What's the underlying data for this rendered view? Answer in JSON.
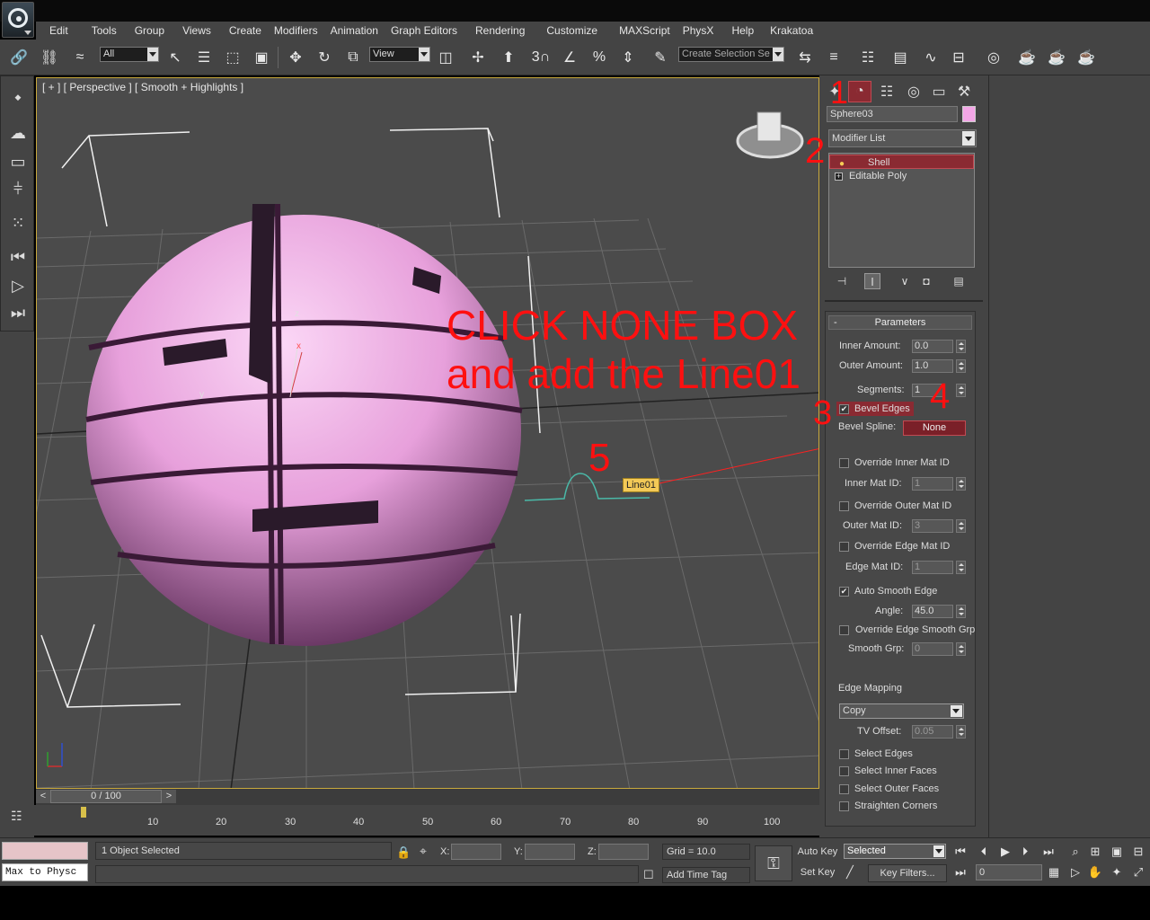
{
  "app": {
    "logo_icon": "max-logo-icon"
  },
  "menubar": {
    "items": [
      "Edit",
      "Tools",
      "Group",
      "Views",
      "Create",
      "Modifiers",
      "Animation",
      "Graph Editors",
      "Rendering",
      "Customize",
      "MAXScript",
      "PhysX",
      "Help",
      "Krakatoa"
    ]
  },
  "toolbar": {
    "selection_filter": "All",
    "ref_coord": "View",
    "named_selection_placeholder": "Create Selection Se"
  },
  "viewport": {
    "label": "[ + ] [ Perspective ] [ Smooth + Highlights ]",
    "annotation_main_line1": "CLICK NONE BOX",
    "annotation_main_line2": "and add the Line01",
    "step_numbers": [
      "1",
      "2",
      "3",
      "4",
      "5"
    ],
    "line_tag": "Line01",
    "axis_x": "x",
    "axis_y": "y",
    "axis_z": "z",
    "sphere_color": "#f3a6e6",
    "annotation_color": "#ff1010"
  },
  "timeslider": {
    "position_text": "0 / 100",
    "prev": "<",
    "next": ">",
    "ticks": [
      "10",
      "20",
      "30",
      "40",
      "50",
      "60",
      "70",
      "80",
      "90",
      "100"
    ]
  },
  "command_panel": {
    "object_name": "Sphere03",
    "object_color": "#f3a6e6",
    "modifier_list": "Modifier List",
    "stack": [
      "Shell",
      "Editable Poly"
    ],
    "rollout_title": "Parameters",
    "rollout_toggle": "-",
    "params": {
      "inner_amount_label": "Inner Amount:",
      "inner_amount": "0.0",
      "outer_amount_label": "Outer Amount:",
      "outer_amount": "1.0",
      "segments_label": "Segments:",
      "segments": "1",
      "bevel_edges_label": "Bevel Edges",
      "bevel_spline_label": "Bevel Spline:",
      "bevel_spline_value": "None",
      "override_inner_label": "Override Inner Mat ID",
      "inner_mat_id_label": "Inner Mat ID:",
      "inner_mat_id": "1",
      "override_outer_label": "Override Outer Mat ID",
      "outer_mat_id_label": "Outer Mat ID:",
      "outer_mat_id": "3",
      "override_edge_label": "Override Edge Mat ID",
      "edge_mat_id_label": "Edge Mat ID:",
      "edge_mat_id": "1",
      "auto_smooth_label": "Auto Smooth Edge",
      "angle_label": "Angle:",
      "angle": "45.0",
      "override_smooth_label": "Override Edge Smooth Grp",
      "smooth_grp_label": "Smooth Grp:",
      "smooth_grp": "0",
      "edge_mapping_label": "Edge Mapping",
      "edge_mapping_value": "Copy",
      "tv_offset_label": "TV Offset:",
      "tv_offset": "0.05",
      "select_edges_label": "Select Edges",
      "select_inner_label": "Select Inner Faces",
      "select_outer_label": "Select Outer Faces",
      "straighten_label": "Straighten Corners"
    }
  },
  "statusbar": {
    "maxscript_text": "Max to Physc",
    "status": "1 Object Selected",
    "x_label": "X:",
    "y_label": "Y:",
    "z_label": "Z:",
    "grid": "Grid = 10.0",
    "add_time_tag": "Add Time Tag",
    "auto_key": "Auto Key",
    "set_key": "Set Key",
    "key_mode": "Selected",
    "key_filters": "Key Filters...",
    "frame": "0"
  }
}
